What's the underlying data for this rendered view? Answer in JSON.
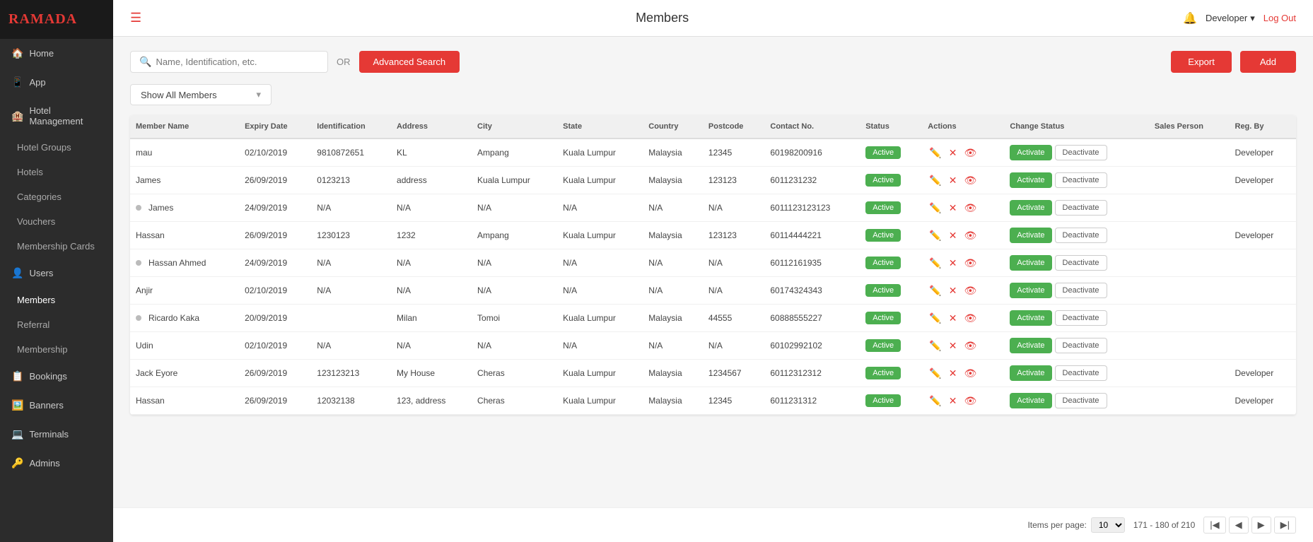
{
  "app": {
    "logo": "RAMADA",
    "title": "Members"
  },
  "header": {
    "title": "Members",
    "user": "Developer",
    "logout_label": "Log Out"
  },
  "sidebar": {
    "items": [
      {
        "label": "Home",
        "icon": "🏠",
        "id": "home"
      },
      {
        "label": "App",
        "icon": "📱",
        "id": "app"
      },
      {
        "label": "Hotel Management",
        "icon": "🏨",
        "id": "hotel-management"
      },
      {
        "label": "Hotel Groups",
        "icon": "",
        "id": "hotel-groups",
        "sub": true
      },
      {
        "label": "Hotels",
        "icon": "",
        "id": "hotels",
        "sub": true
      },
      {
        "label": "Categories",
        "icon": "",
        "id": "categories",
        "sub": true
      },
      {
        "label": "Vouchers",
        "icon": "",
        "id": "vouchers",
        "sub": true
      },
      {
        "label": "Membership Cards",
        "icon": "",
        "id": "membership-cards",
        "sub": true
      },
      {
        "label": "Users",
        "icon": "👤",
        "id": "users"
      },
      {
        "label": "Members",
        "icon": "",
        "id": "members",
        "sub": true,
        "active": true
      },
      {
        "label": "Referral",
        "icon": "",
        "id": "referral",
        "sub": true
      },
      {
        "label": "Membership",
        "icon": "",
        "id": "membership",
        "sub": true
      },
      {
        "label": "Bookings",
        "icon": "📋",
        "id": "bookings"
      },
      {
        "label": "Banners",
        "icon": "🖼️",
        "id": "banners"
      },
      {
        "label": "Terminals",
        "icon": "💻",
        "id": "terminals"
      },
      {
        "label": "Admins",
        "icon": "🔑",
        "id": "admins"
      }
    ]
  },
  "toolbar": {
    "search_placeholder": "Name, Identification, etc.",
    "or_text": "OR",
    "advanced_search_label": "Advanced Search",
    "export_label": "Export",
    "add_label": "Add"
  },
  "filter": {
    "label": "Show All Members"
  },
  "table": {
    "columns": [
      "Member Name",
      "Expiry Date",
      "Identification",
      "Address",
      "City",
      "State",
      "Country",
      "Postcode",
      "Contact No.",
      "Status",
      "Actions",
      "Change Status",
      "Sales Person",
      "Reg. By"
    ],
    "rows": [
      {
        "name": "mau",
        "dot": false,
        "expiry": "02/10/2019",
        "identification": "9810872651",
        "address": "KL",
        "city": "Ampang",
        "state": "Kuala Lumpur",
        "country": "Malaysia",
        "postcode": "12345",
        "contact": "60198200916",
        "status": "Active",
        "sales": "",
        "reg_by": "Developer"
      },
      {
        "name": "James",
        "dot": false,
        "expiry": "26/09/2019",
        "identification": "0123213",
        "address": "address",
        "city": "Kuala Lumpur",
        "state": "Kuala Lumpur",
        "country": "Malaysia",
        "postcode": "123123",
        "contact": "6011231232",
        "status": "Active",
        "sales": "",
        "reg_by": "Developer"
      },
      {
        "name": "James",
        "dot": true,
        "expiry": "24/09/2019",
        "identification": "N/A",
        "address": "N/A",
        "city": "N/A",
        "state": "N/A",
        "country": "N/A",
        "postcode": "N/A",
        "contact": "6011123123123",
        "status": "Active",
        "sales": "",
        "reg_by": ""
      },
      {
        "name": "Hassan",
        "dot": false,
        "expiry": "26/09/2019",
        "identification": "1230123",
        "address": "1232",
        "city": "Ampang",
        "state": "Kuala Lumpur",
        "country": "Malaysia",
        "postcode": "123123",
        "contact": "60114444221",
        "status": "Active",
        "sales": "",
        "reg_by": "Developer"
      },
      {
        "name": "Hassan Ahmed",
        "dot": true,
        "expiry": "24/09/2019",
        "identification": "N/A",
        "address": "N/A",
        "city": "N/A",
        "state": "N/A",
        "country": "N/A",
        "postcode": "N/A",
        "contact": "60112161935",
        "status": "Active",
        "sales": "",
        "reg_by": ""
      },
      {
        "name": "Anjir",
        "dot": false,
        "expiry": "02/10/2019",
        "identification": "N/A",
        "address": "N/A",
        "city": "N/A",
        "state": "N/A",
        "country": "N/A",
        "postcode": "N/A",
        "contact": "60174324343",
        "status": "Active",
        "sales": "",
        "reg_by": ""
      },
      {
        "name": "Ricardo Kaka",
        "dot": true,
        "expiry": "20/09/2019",
        "identification": "",
        "address": "Milan",
        "city": "Tomoi",
        "state": "Kuala Lumpur",
        "country": "Malaysia",
        "postcode": "44555",
        "contact": "60888555227",
        "status": "Active",
        "sales": "",
        "reg_by": ""
      },
      {
        "name": "Udin",
        "dot": false,
        "expiry": "02/10/2019",
        "identification": "N/A",
        "address": "N/A",
        "city": "N/A",
        "state": "N/A",
        "country": "N/A",
        "postcode": "N/A",
        "contact": "60102992102",
        "status": "Active",
        "sales": "",
        "reg_by": ""
      },
      {
        "name": "Jack Eyore",
        "dot": false,
        "expiry": "26/09/2019",
        "identification": "123123213",
        "address": "My House",
        "city": "Cheras",
        "state": "Kuala Lumpur",
        "country": "Malaysia",
        "postcode": "1234567",
        "contact": "60112312312",
        "status": "Active",
        "sales": "",
        "reg_by": "Developer"
      },
      {
        "name": "Hassan",
        "dot": false,
        "expiry": "26/09/2019",
        "identification": "12032138",
        "address": "123, address",
        "city": "Cheras",
        "state": "Kuala Lumpur",
        "country": "Malaysia",
        "postcode": "12345",
        "contact": "6011231312",
        "status": "Active",
        "sales": "",
        "reg_by": "Developer"
      }
    ],
    "activate_label": "Activate",
    "deactivate_label": "Deactivate"
  },
  "pagination": {
    "items_per_page_label": "Items per page:",
    "per_page": "10",
    "range": "171 - 180 of 210"
  }
}
